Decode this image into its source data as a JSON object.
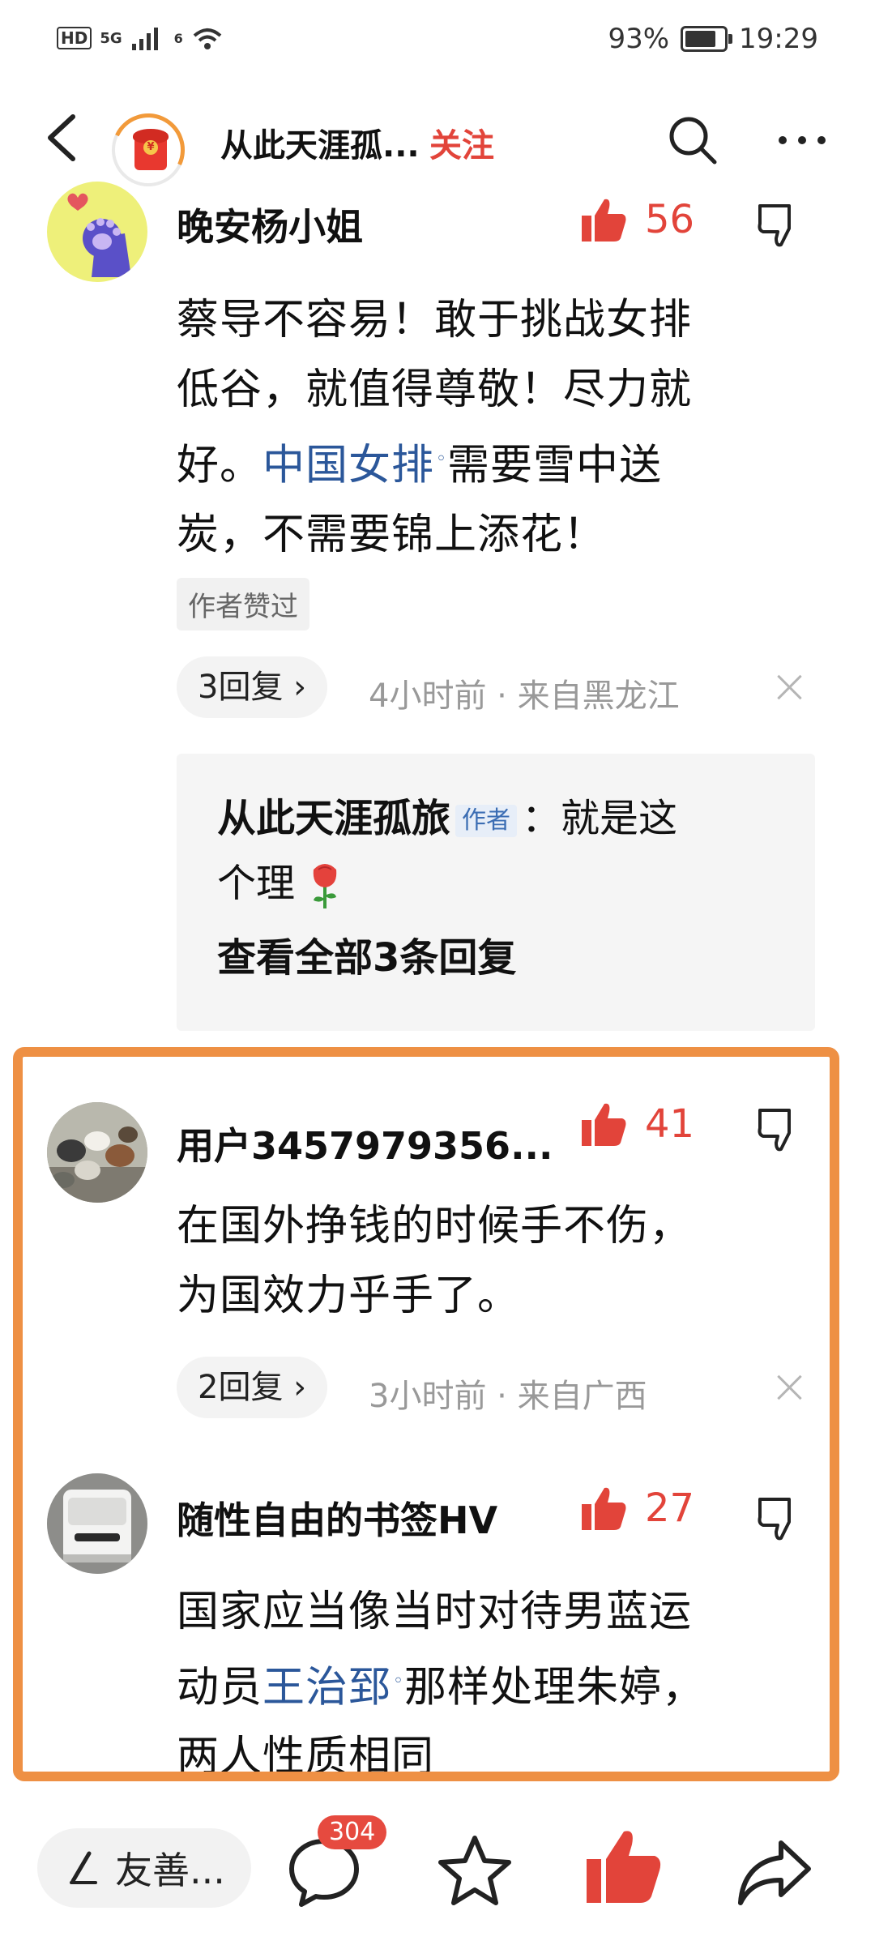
{
  "status_bar": {
    "left_badge": "HD",
    "signal_label": "5G",
    "wifi_label": "6",
    "battery": "93%",
    "battery_level": 0.93,
    "time": "19:29"
  },
  "header": {
    "channel_name": "从此天涯孤...",
    "follow_label": "关注"
  },
  "comments": [
    {
      "username": "晚安杨小姐",
      "likes": "56",
      "text_lines": [
        "蔡导不容易！敢于挑战女排",
        "低谷，就值得尊敬！尽力就"
      ],
      "line3_pre": "好。",
      "keyword": "中国女排",
      "line3_post": "需要雪中送",
      "line4": "炭，不需要锦上添花！",
      "badge": "作者赞过",
      "replies_label": "3回复",
      "meta": "4小时前 · 来自黑龙江",
      "reply": {
        "author": "从此天涯孤旅",
        "author_tag": "作者",
        "text_line1": "：就是这",
        "text_line2": "个理",
        "view_all": "查看全部3条回复"
      }
    },
    {
      "username": "用户3457979356...",
      "likes": "41",
      "text_lines": [
        "在国外挣钱的时候手不伤，",
        "为国效力乎手了。"
      ],
      "replies_label": "2回复",
      "meta": "3小时前 · 来自广西"
    },
    {
      "username": "随性自由的书签HV",
      "likes": "27",
      "line1": "国家应当像当时对待男蓝运",
      "line2_pre": "动员",
      "keyword": "王治郅",
      "line2_post": "那样处理朱婷，",
      "line3": "两人性质相同"
    }
  ],
  "bottom_bar": {
    "input_placeholder": "友善...",
    "comment_count": "304"
  },
  "colors": {
    "accent_red": "#e2443a",
    "highlight_orange": "#ee9044",
    "link_blue": "#2b579a"
  },
  "icons": [
    "back-icon",
    "search-icon",
    "more-icon",
    "thumb-up-icon",
    "thumb-down-icon",
    "close-icon",
    "pen-icon",
    "comment-icon",
    "star-icon",
    "share-icon"
  ]
}
